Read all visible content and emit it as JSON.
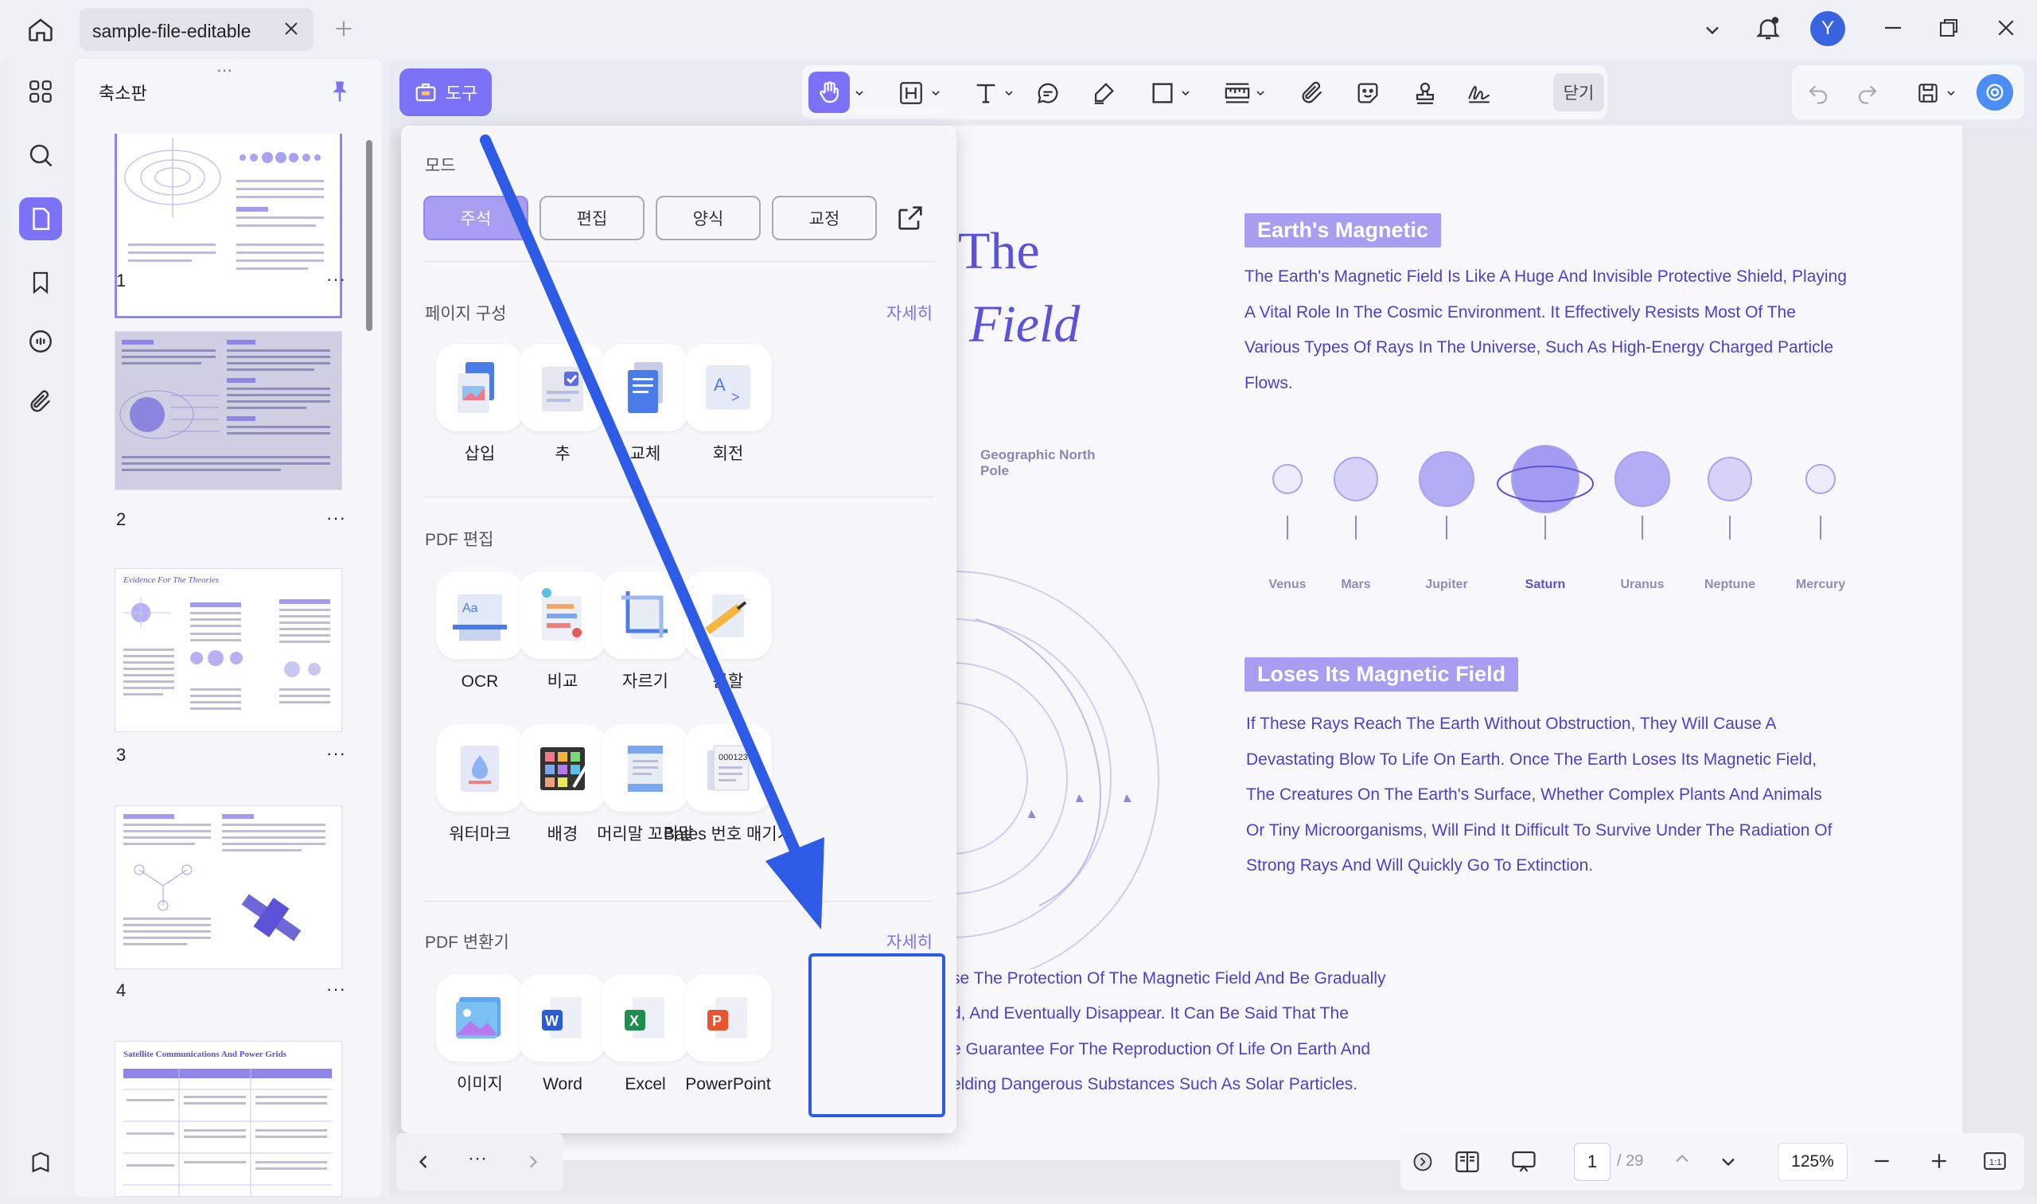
{
  "tab": {
    "title": "sample-file-editable"
  },
  "user": {
    "initial": "Y"
  },
  "sidebar": {
    "title": "축소판"
  },
  "thumbnails": [
    {
      "page": "1"
    },
    {
      "page": "2"
    },
    {
      "page": "3",
      "heading": "Evidence For The Theories"
    },
    {
      "page": "4"
    },
    {
      "heading": "Satellite Communications And Power Grids"
    }
  ],
  "toolbar": {
    "tools_label": "도구",
    "close_label": "닫기"
  },
  "popup": {
    "mode_title": "모드",
    "modes": [
      "주석",
      "편집",
      "양식",
      "교정"
    ],
    "page_section": {
      "title": "페이지 구성",
      "more": "자세히",
      "items": [
        "삽입",
        "추",
        "교체",
        "회전"
      ]
    },
    "edit_section": {
      "title": "PDF 편집",
      "items": [
        "OCR",
        "비교",
        "자르기",
        "분할",
        "워터마크",
        "배경",
        "머리말 꼬리말",
        "Bates 번호 매기기"
      ]
    },
    "convert_section": {
      "title": "PDF 변환기",
      "more": "자세히",
      "items": [
        "이미지",
        "Word",
        "Excel",
        "PowerPoint"
      ]
    }
  },
  "document": {
    "title_line1": "The",
    "title_line2": "Field",
    "tag1": "Earth's Magnetic",
    "para1": "The Earth's Magnetic Field Is Like A Huge And Invisible Protective Shield, Playing A Vital Role In The Cosmic Environment. It Effectively Resists Most Of The Various Types Of Rays In The Universe, Such As High-Energy Charged Particle Flows.",
    "pole_label": "Geographic North Pole",
    "planets": [
      "Venus",
      "Mars",
      "Jupiter",
      "Saturn",
      "Uranus",
      "Neptune",
      "Mercury"
    ],
    "tag2": "Loses Its Magnetic Field",
    "para2": "If These Rays Reach The Earth Without Obstruction, They Will Cause A Devastating Blow To Life On Earth. Once The Earth Loses Its Magnetic Field, The Creatures On The Earth's Surface, Whether Complex Plants And Animals Or Tiny Microorganisms, Will Find It Difficult To Survive Under The Radiation Of Strong Rays And Will Quickly Go To Extinction.",
    "bottom_lines": [
      "se The Protection Of The Magnetic Field And Be Gradually",
      "d, And Eventually Disappear. It Can Be Said That The",
      "e Guarantee For The Reproduction Of Life On Earth And",
      "elding Dangerous Substances Such As Solar Particles."
    ]
  },
  "nav": {
    "more": "···"
  },
  "status": {
    "current_page": "1",
    "total_pages": "/ 29",
    "zoom": "125%"
  },
  "colors": {
    "accent": "#7B72F7",
    "highlight": "#2E5BE6",
    "doc_text": "#4B42C7"
  }
}
